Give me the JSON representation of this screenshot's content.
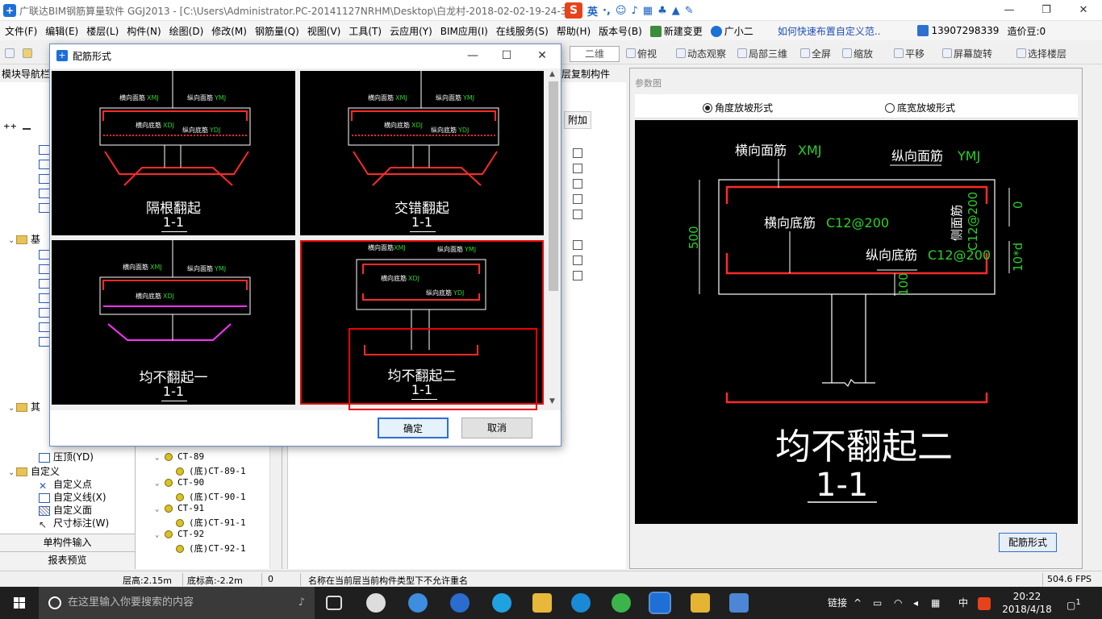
{
  "window": {
    "title": "广联达BIM钢筋算量软件 GGJ2013 - [C:\\Users\\Administrator.PC-20141127NRHM\\Desktop\\白龙村-2018-02-02-19-24-35"
  },
  "ime": {
    "lang": "英"
  },
  "menu": {
    "items": [
      "文件(F)",
      "编辑(E)",
      "楼层(L)",
      "构件(N)",
      "绘图(D)",
      "修改(M)",
      "钢筋量(Q)",
      "视图(V)",
      "工具(T)",
      "云应用(Y)",
      "BIM应用(I)",
      "在线服务(S)",
      "帮助(H)",
      "版本号(B)"
    ],
    "new_change": "新建变更",
    "assistant": "广小二",
    "link": "如何快速布置自定义范..",
    "phone": "13907298339",
    "beans": "造价豆:0"
  },
  "toolbar": {
    "view_mode": "二维",
    "buttons": [
      "俯视",
      "动态观察",
      "局部三维",
      "全屏",
      "缩放",
      "平移",
      "屏幕旋转",
      "选择楼层"
    ]
  },
  "toolbar2": {
    "nav_title": "模块导航栏",
    "floor_copy": "层复制构件"
  },
  "left_nav": {
    "tree": [
      {
        "label": "基",
        "type": "folder"
      },
      {
        "label": "其",
        "type": "folder"
      },
      {
        "label": "压顶(YD)",
        "type": "leaf"
      },
      {
        "label": "自定义",
        "type": "folder"
      },
      {
        "label": "自定义点",
        "type": "leaf"
      },
      {
        "label": "自定义线(X)",
        "type": "leaf"
      },
      {
        "label": "自定义面",
        "type": "leaf"
      },
      {
        "label": "尺寸标注(W)",
        "type": "leaf"
      }
    ],
    "single_input": "单构件输入",
    "report_preview": "报表预览"
  },
  "component_list": [
    {
      "label": "CT-89",
      "level": 0
    },
    {
      "label": "(底)CT-89-1",
      "level": 1
    },
    {
      "label": "CT-90",
      "level": 0
    },
    {
      "label": "(底)CT-90-1",
      "level": 1
    },
    {
      "label": "CT-91",
      "level": 0
    },
    {
      "label": "(底)CT-91-1",
      "level": 1
    },
    {
      "label": "CT-92",
      "level": 0
    },
    {
      "label": "(底)CT-92-1",
      "level": 1
    }
  ],
  "grid": {
    "header": "附加"
  },
  "param_panel": {
    "title": "参数图",
    "radio_angle": "角度放坡形式",
    "radio_width": "底宽放坡形式",
    "drawing": {
      "transverse_top": "横向面筋",
      "transverse_top_code": "XMJ",
      "longitudinal_top": "纵向面筋",
      "longitudinal_top_code": "YMJ",
      "transverse_bottom": "横向底筋",
      "transverse_bottom_code": "C12@200",
      "longitudinal_bottom": "纵向底筋",
      "longitudinal_bottom_code": "C12@200",
      "side": "侧面筋",
      "side_code": "C12@200",
      "dim_500": "500",
      "dim_0": "0",
      "dim_100": "100",
      "dim_10d": "10*d",
      "caption": "均不翻起二",
      "section": "1-1"
    },
    "button": "配筋形式"
  },
  "dialog": {
    "title": "配筋形式",
    "options": [
      {
        "caption": "隔根翻起",
        "section": "1-1"
      },
      {
        "caption": "交错翻起",
        "section": "1-1"
      },
      {
        "caption": "均不翻起一",
        "section": "1-1"
      },
      {
        "caption": "均不翻起二",
        "section": "1-1"
      }
    ],
    "tile_labels": {
      "transverse_top": "横向面筋",
      "xmj": "XMJ",
      "longitudinal_top": "纵向面筋",
      "ymj": "YMJ",
      "transverse_bottom": "横向底筋",
      "xdj": "XDJ",
      "longitudinal_bottom": "纵向底筋",
      "ydj": "YDJ"
    },
    "ok": "确定",
    "cancel": "取消"
  },
  "status": {
    "floor_height": "层高:2.15m",
    "bottom_height": "底标高:-2.2m",
    "zero": "0",
    "message": "名称在当前层当前构件类型下不允许重名",
    "fps": "504.6 FPS"
  },
  "taskbar": {
    "search_placeholder": "在这里输入你要搜索的内容",
    "link": "链接",
    "lang": "中",
    "time": "20:22",
    "date": "2018/4/18",
    "notif_count": "1"
  },
  "colors": {
    "rebar_red": "#ff2a2a",
    "label_green": "#2bd12b",
    "accent_blue": "#1e6fd6",
    "magenta": "#ff33ff"
  }
}
